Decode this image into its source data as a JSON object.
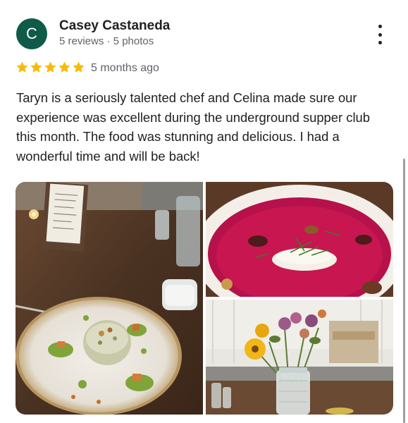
{
  "reviewer": {
    "initial": "C",
    "name": "Casey Castaneda",
    "meta": "5 reviews · 5 photos",
    "avatar_color": "#0f5a48"
  },
  "rating": {
    "stars": 5,
    "max": 5,
    "color": "#f6bb06"
  },
  "time": "5 months ago",
  "review_text": "Taryn is a seriously talented chef and Celina made sure our experience was excellent during the underground supper club this month. The food was stunning and delicious. I had a wonderful time and will be back!",
  "menu_icon": "more-vert-icon",
  "photos": [
    {
      "subject": "plated-dish-with-herb-dots"
    },
    {
      "subject": "beet-soup-bowl"
    },
    {
      "subject": "flower-vase-on-table"
    }
  ]
}
